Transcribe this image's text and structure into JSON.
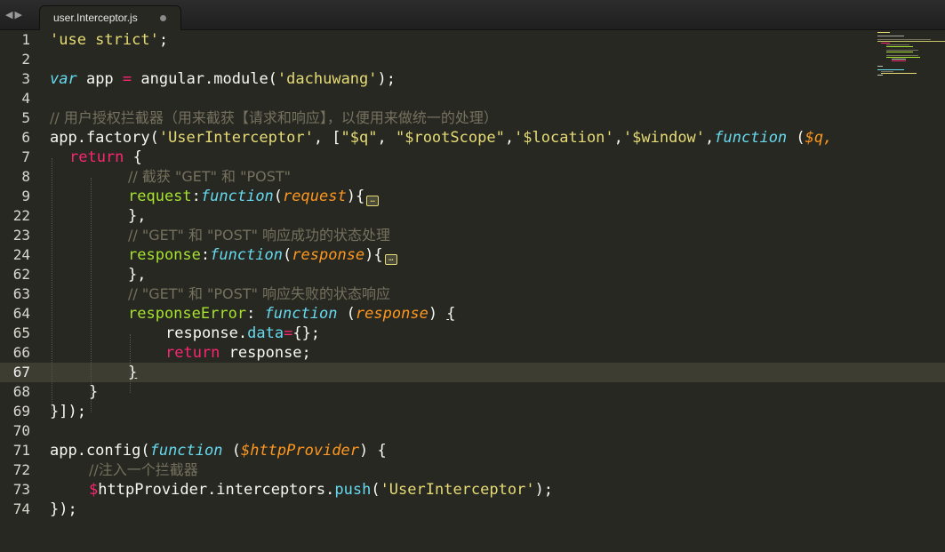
{
  "editor": {
    "nav_back": "◀",
    "nav_forward": "▶",
    "active_tab": "user.Interceptor.js",
    "active_line_number": "67"
  },
  "gutter": {
    "line_numbers": [
      "1",
      "2",
      "3",
      "4",
      "5",
      "6",
      "7",
      "8",
      "9",
      "22",
      "23",
      "24",
      "62",
      "63",
      "64",
      "65",
      "66",
      "67",
      "68",
      "69",
      "70",
      "71",
      "72",
      "73",
      "74"
    ]
  },
  "code": {
    "l1_str": "'use strict'",
    "l1_end": ";",
    "l3_var": "var",
    "l3_app": " app ",
    "l3_eq": "=",
    "l3_mid": " angular.module(",
    "l3_str": "'dachuwang'",
    "l3_end": ");",
    "l5_cmt": "// 用户授权拦截器（用来截获【请求和响应】，以便用来做统一的处理）",
    "l6_a": "app.factory(",
    "l6_s1": "'UserInterceptor'",
    "l6_b": ", [",
    "l6_s2": "\"$q\"",
    "l6_c": ", ",
    "l6_s3": "\"$rootScope\"",
    "l6_d": ",",
    "l6_s4": "'$location'",
    "l6_e": ",",
    "l6_s5": "'$window'",
    "l6_f": ",",
    "l6_fn": "function",
    "l6_g": " (",
    "l6_p": "$q,",
    "l7_kw": "return",
    "l7_b": " {",
    "l8_cmt": "// 截获 \"GET\" 和 \"POST\"",
    "l9_prop": "request",
    "l9_colon": ":",
    "l9_fn": "function",
    "l9_open": "(",
    "l9_p": "request",
    "l9_close": "){",
    "l22": "},",
    "l23_cmt": "// \"GET\" 和 \"POST\" 响应成功的状态处理",
    "l24_prop": "response",
    "l24_colon": ":",
    "l24_fn": "function",
    "l24_open": "(",
    "l24_p": "response",
    "l24_close": "){",
    "l62": "},",
    "l63_cmt": "// \"GET\" 和 \"POST\" 响应失败的状态响应",
    "l64_prop": "responseError",
    "l64_colon": ": ",
    "l64_fn": "function",
    "l64_open": " (",
    "l64_p": "response",
    "l64_close": ") ",
    "l64_brace": "{",
    "l65_a": "response.",
    "l65_data": "data",
    "l65_eq": "=",
    "l65_b": "{};",
    "l66_kw": "return",
    "l66_b": " response;",
    "l67": "}",
    "l68": "}",
    "l69": "}]);",
    "l71_a": "app.config(",
    "l71_fn": "function",
    "l71_open": " (",
    "l71_p": "$httpProvider",
    "l71_close": ") {",
    "l72_cmt": "//注入一个拦截器",
    "l73_dollar": "$",
    "l73_a": "httpProvider.interceptors.",
    "l73_push": "push",
    "l73_open": "(",
    "l73_str": "'UserInterceptor'",
    "l73_close": ");",
    "l74": "});",
    "fold_glyph": "…"
  },
  "colors": {
    "background": "#272822",
    "keyword": "#f92672",
    "string": "#e6db74",
    "function": "#66d9ef",
    "parameter": "#fd971f",
    "comment": "#75715e",
    "property": "#a6e22e"
  }
}
